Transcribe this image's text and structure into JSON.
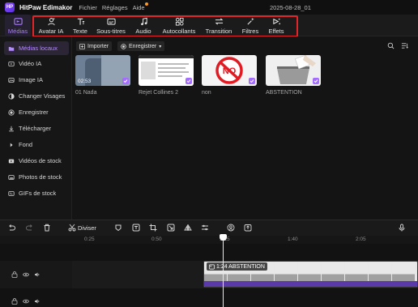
{
  "app": {
    "logo_text": "HP",
    "name": "HitPaw Edimakor",
    "menu": [
      "Fichier",
      "Réglages",
      "Aide"
    ],
    "project_title": "2025-08-28_01"
  },
  "toolbar": {
    "items": [
      {
        "label": "Médias",
        "icon": "media-icon",
        "active": true
      },
      {
        "label": "Avatar IA",
        "icon": "avatar-icon"
      },
      {
        "label": "Texte",
        "icon": "text-icon"
      },
      {
        "label": "Sous-titres",
        "icon": "subtitles-icon"
      },
      {
        "label": "Audio",
        "icon": "audio-icon"
      },
      {
        "label": "Autocollants",
        "icon": "stickers-icon"
      },
      {
        "label": "Transition",
        "icon": "transition-icon"
      },
      {
        "label": "Filtres",
        "icon": "filters-icon"
      },
      {
        "label": "Effets",
        "icon": "effects-icon"
      }
    ],
    "highlight_color": "#e0252b"
  },
  "sidebar": {
    "items": [
      {
        "label": "Médias locaux",
        "icon": "folder-icon",
        "active": true
      },
      {
        "label": "Vidéo IA",
        "icon": "video-ai-icon"
      },
      {
        "label": "Image IA",
        "icon": "image-ai-icon"
      },
      {
        "label": "Changer Visages",
        "icon": "face-swap-icon"
      },
      {
        "label": "Enregistrer",
        "icon": "record-icon"
      },
      {
        "label": "Télécharger",
        "icon": "download-icon"
      },
      {
        "label": "Fond",
        "icon": "background-icon"
      },
      {
        "label": "Vidéos de stock",
        "icon": "stock-video-icon"
      },
      {
        "label": "Photos de stock",
        "icon": "stock-photo-icon"
      },
      {
        "label": "GIFs de stock",
        "icon": "gif-icon"
      }
    ]
  },
  "main": {
    "import_label": "Importer",
    "record_label": "Enregistrer",
    "media": [
      {
        "label": "01 Nada",
        "duration": "02:53"
      },
      {
        "label": "Rejet Collines 2"
      },
      {
        "label": "non"
      },
      {
        "label": "ABSTENTION"
      }
    ]
  },
  "timeline": {
    "split_label": "Diviser",
    "ruler": [
      "0:25",
      "0:50",
      "1:15",
      "1:40",
      "2:05"
    ],
    "clip_label": "1:24 ABSTENTION"
  },
  "colors": {
    "accent": "#a46cff",
    "background": "#121212"
  }
}
